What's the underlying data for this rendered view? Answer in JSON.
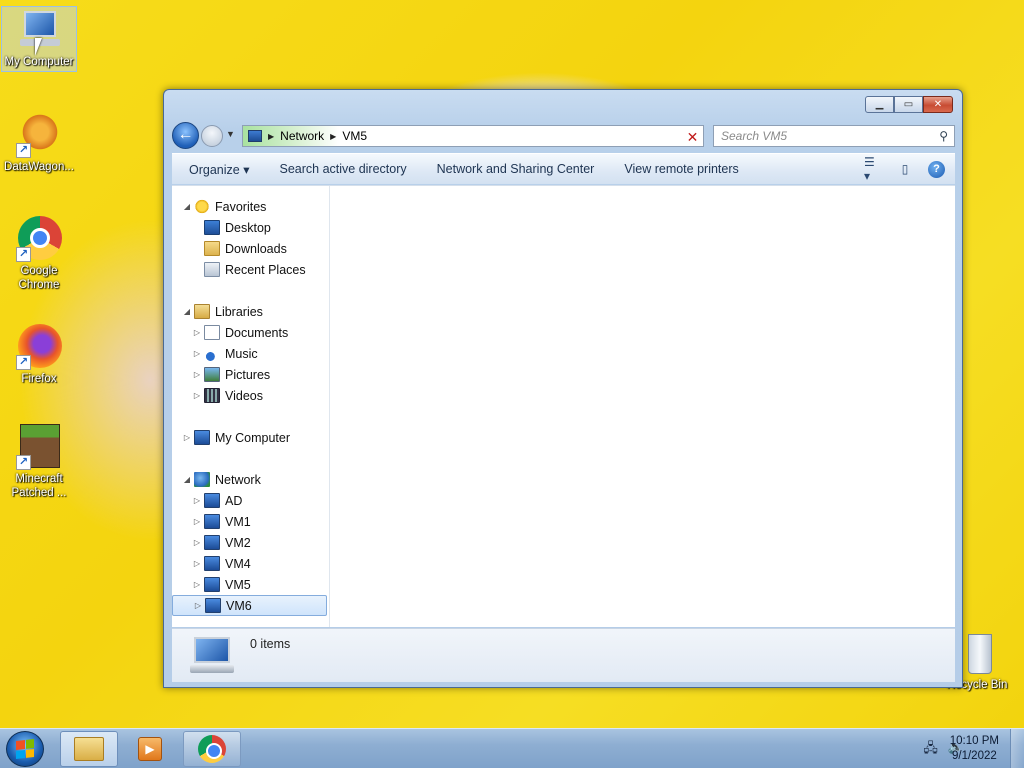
{
  "desktop": {
    "icons": [
      {
        "label": "My Computer"
      },
      {
        "label": "DataWagon..."
      },
      {
        "label": "Google Chrome"
      },
      {
        "label": "Firefox"
      },
      {
        "label": "Minecraft Patched ..."
      },
      {
        "label": "Recycle Bin"
      }
    ]
  },
  "window": {
    "address": {
      "crumbs": [
        "Network",
        "VM5"
      ]
    },
    "search": {
      "placeholder": "Search VM5"
    },
    "toolbar": {
      "organize": "Organize",
      "search_ad": "Search active directory",
      "network_center": "Network and Sharing Center",
      "remote_printers": "View remote printers"
    },
    "navpane": {
      "favorites": {
        "label": "Favorites",
        "items": [
          "Desktop",
          "Downloads",
          "Recent Places"
        ]
      },
      "libraries": {
        "label": "Libraries",
        "items": [
          "Documents",
          "Music",
          "Pictures",
          "Videos"
        ]
      },
      "computer": {
        "label": "My Computer"
      },
      "network": {
        "label": "Network",
        "items": [
          "AD",
          "VM1",
          "VM2",
          "VM4",
          "VM5",
          "VM6"
        ]
      }
    },
    "status": {
      "text": "0 items"
    }
  },
  "taskbar": {
    "clock_time": "10:10 PM",
    "clock_date": "9/1/2022"
  }
}
